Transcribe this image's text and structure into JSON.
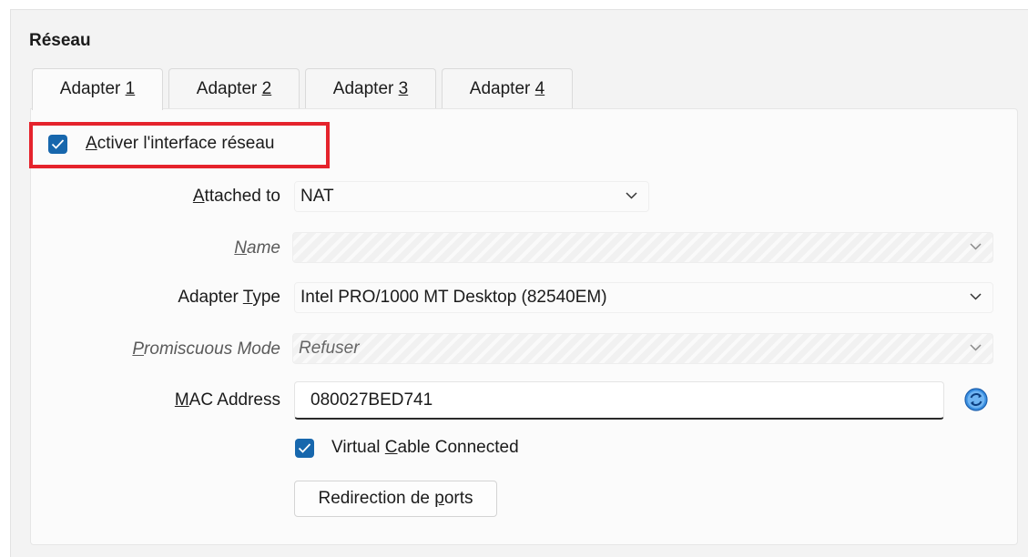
{
  "section": {
    "title": "Réseau"
  },
  "tabs": [
    {
      "label": "Adapter ",
      "mnemonic": "1"
    },
    {
      "label": "Adapter ",
      "mnemonic": "2"
    },
    {
      "label": "Adapter ",
      "mnemonic": "3"
    },
    {
      "label": "Adapter ",
      "mnemonic": "4"
    }
  ],
  "enable_interface": {
    "mnemonic": "A",
    "label_rest": "ctiver l'interface réseau",
    "checked": true
  },
  "attached_to": {
    "mnemonic": "A",
    "label_rest": "ttached to",
    "value": "NAT"
  },
  "name": {
    "mnemonic": "N",
    "label_rest": "ame",
    "value": ""
  },
  "adapter_type": {
    "label_pre": "Adapter ",
    "mnemonic": "T",
    "label_rest": "ype",
    "value": "Intel PRO/1000 MT Desktop (82540EM)"
  },
  "promiscuous": {
    "mnemonic": "P",
    "label_rest": "romiscuous Mode",
    "value": "Refuser"
  },
  "mac": {
    "mnemonic": "M",
    "label_rest": "AC Address",
    "value": "080027BED741",
    "refresh_icon": "refresh-icon"
  },
  "cable": {
    "label_pre": "Virtual ",
    "mnemonic": "C",
    "label_rest": "able Connected",
    "checked": true
  },
  "port_forwarding": {
    "label_pre": "Redirection de ",
    "mnemonic": "p",
    "label_rest": "orts"
  },
  "colors": {
    "accent": "#1767ad",
    "highlight": "#e5232c"
  }
}
